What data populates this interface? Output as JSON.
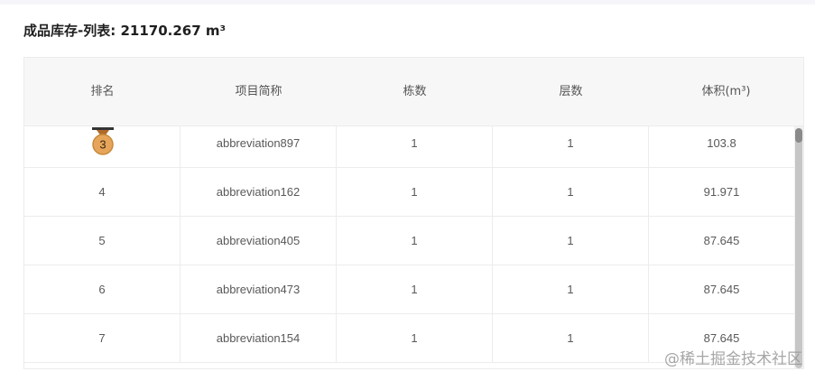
{
  "title": "成品库存-列表: 21170.267 m³",
  "table": {
    "headers": [
      "排名",
      "项目简称",
      "栋数",
      "层数",
      "体积(m³)"
    ],
    "rows": [
      {
        "rank": "",
        "name": "",
        "buildings": "",
        "floors": "",
        "volume": ""
      },
      {
        "rank": "3",
        "name": "abbreviation897",
        "buildings": "1",
        "floors": "1",
        "volume": "103.8",
        "medal": true
      },
      {
        "rank": "4",
        "name": "abbreviation162",
        "buildings": "1",
        "floors": "1",
        "volume": "91.971"
      },
      {
        "rank": "5",
        "name": "abbreviation405",
        "buildings": "1",
        "floors": "1",
        "volume": "87.645"
      },
      {
        "rank": "6",
        "name": "abbreviation473",
        "buildings": "1",
        "floors": "1",
        "volume": "87.645"
      },
      {
        "rank": "7",
        "name": "abbreviation154",
        "buildings": "1",
        "floors": "1",
        "volume": "87.645"
      }
    ]
  },
  "watermark": "@稀土掘金技术社区",
  "colors": {
    "medal_bronze": "#e6a55a",
    "medal_border": "#c78a3a",
    "ribbon": "#333333"
  }
}
